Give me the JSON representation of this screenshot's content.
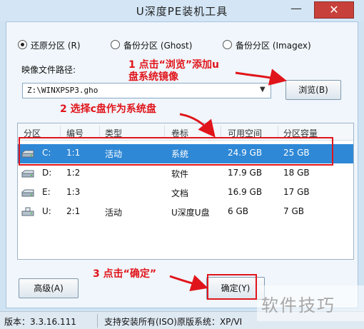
{
  "window": {
    "title": "U深度PE装机工具",
    "minimize_glyph": "—",
    "close_glyph": "✕"
  },
  "radio_options": [
    {
      "label": "还原分区 (R)",
      "selected": true
    },
    {
      "label": "备份分区 (Ghost)",
      "selected": false
    },
    {
      "label": "备份分区 (Imagex)",
      "selected": false
    }
  ],
  "image_path": {
    "label": "映像文件路径:",
    "value": "Z:\\WINXPSP3.gho",
    "dropdown_glyph": "▼",
    "browse_button": "浏览(B)"
  },
  "partition_table": {
    "columns": [
      "分区",
      "编号",
      "类型",
      "卷标",
      "可用空间",
      "分区容量"
    ],
    "rows": [
      {
        "icon": "disk-icon",
        "drive": "C:",
        "number": "1:1",
        "type": "活动",
        "label": "系统",
        "free": "24.9 GB",
        "capacity": "25 GB",
        "selected": true
      },
      {
        "icon": "disk-icon",
        "drive": "D:",
        "number": "1:2",
        "type": "",
        "label": "软件",
        "free": "17.9 GB",
        "capacity": "18 GB",
        "selected": false
      },
      {
        "icon": "disk-icon",
        "drive": "E:",
        "number": "1:3",
        "type": "",
        "label": "文档",
        "free": "16.9 GB",
        "capacity": "17 GB",
        "selected": false
      },
      {
        "icon": "usb-drive-icon",
        "drive": "U:",
        "number": "2:1",
        "type": "活动",
        "label": "U深度U盘",
        "free": "6 GB",
        "capacity": "7 GB",
        "selected": false
      }
    ]
  },
  "buttons": {
    "advanced": "高级(A)",
    "ok": "确定(Y)"
  },
  "status": {
    "version": "版本：3.3.16.111",
    "support": "支持安装所有(ISO)原版系统：XP/VI"
  },
  "annotations": {
    "step1_line1": "1 点击“浏览”添加u",
    "step1_line2": "盘系统镜像",
    "step2": "2 选择c盘作为系统盘",
    "step3": "3 点击“确定”",
    "color": "#e0151b"
  },
  "watermark": "软件技巧",
  "colors": {
    "selection": "#2f88d6",
    "close_button": "#c7413a",
    "annotation": "#e0151b"
  }
}
